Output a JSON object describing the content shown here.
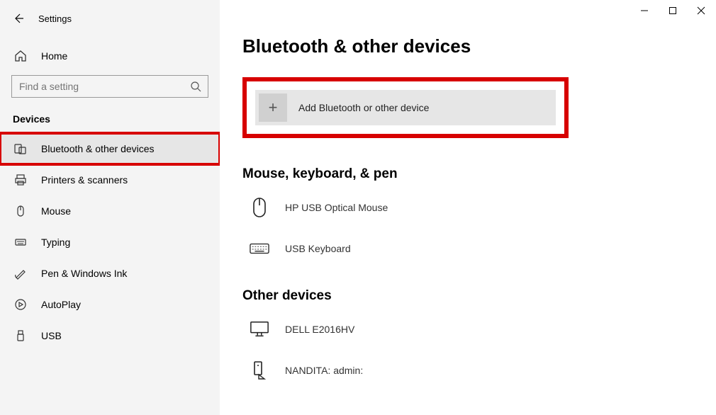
{
  "window": {
    "title": "Settings"
  },
  "sidebar": {
    "home_label": "Home",
    "search_placeholder": "Find a setting",
    "category_label": "Devices",
    "items": [
      {
        "label": "Bluetooth & other devices",
        "icon": "bluetooth-devices-icon",
        "active": true
      },
      {
        "label": "Printers & scanners",
        "icon": "printer-icon"
      },
      {
        "label": "Mouse",
        "icon": "mouse-icon"
      },
      {
        "label": "Typing",
        "icon": "keyboard-icon"
      },
      {
        "label": "Pen & Windows Ink",
        "icon": "pen-icon"
      },
      {
        "label": "AutoPlay",
        "icon": "autoplay-icon"
      },
      {
        "label": "USB",
        "icon": "usb-icon"
      }
    ]
  },
  "page": {
    "title": "Bluetooth & other devices",
    "add_button_label": "Add Bluetooth or other device",
    "sections": [
      {
        "title": "Mouse, keyboard, & pen",
        "devices": [
          {
            "label": "HP USB Optical Mouse",
            "icon": "mouse-device-icon"
          },
          {
            "label": "USB Keyboard",
            "icon": "keyboard-device-icon"
          }
        ]
      },
      {
        "title": "Other devices",
        "devices": [
          {
            "label": "DELL E2016HV",
            "icon": "monitor-icon"
          },
          {
            "label": "NANDITA: admin:",
            "icon": "media-device-icon"
          }
        ]
      }
    ]
  },
  "annotations": {
    "highlighted_nav_item": "Bluetooth & other devices",
    "highlighted_action": "Add Bluetooth or other device"
  }
}
